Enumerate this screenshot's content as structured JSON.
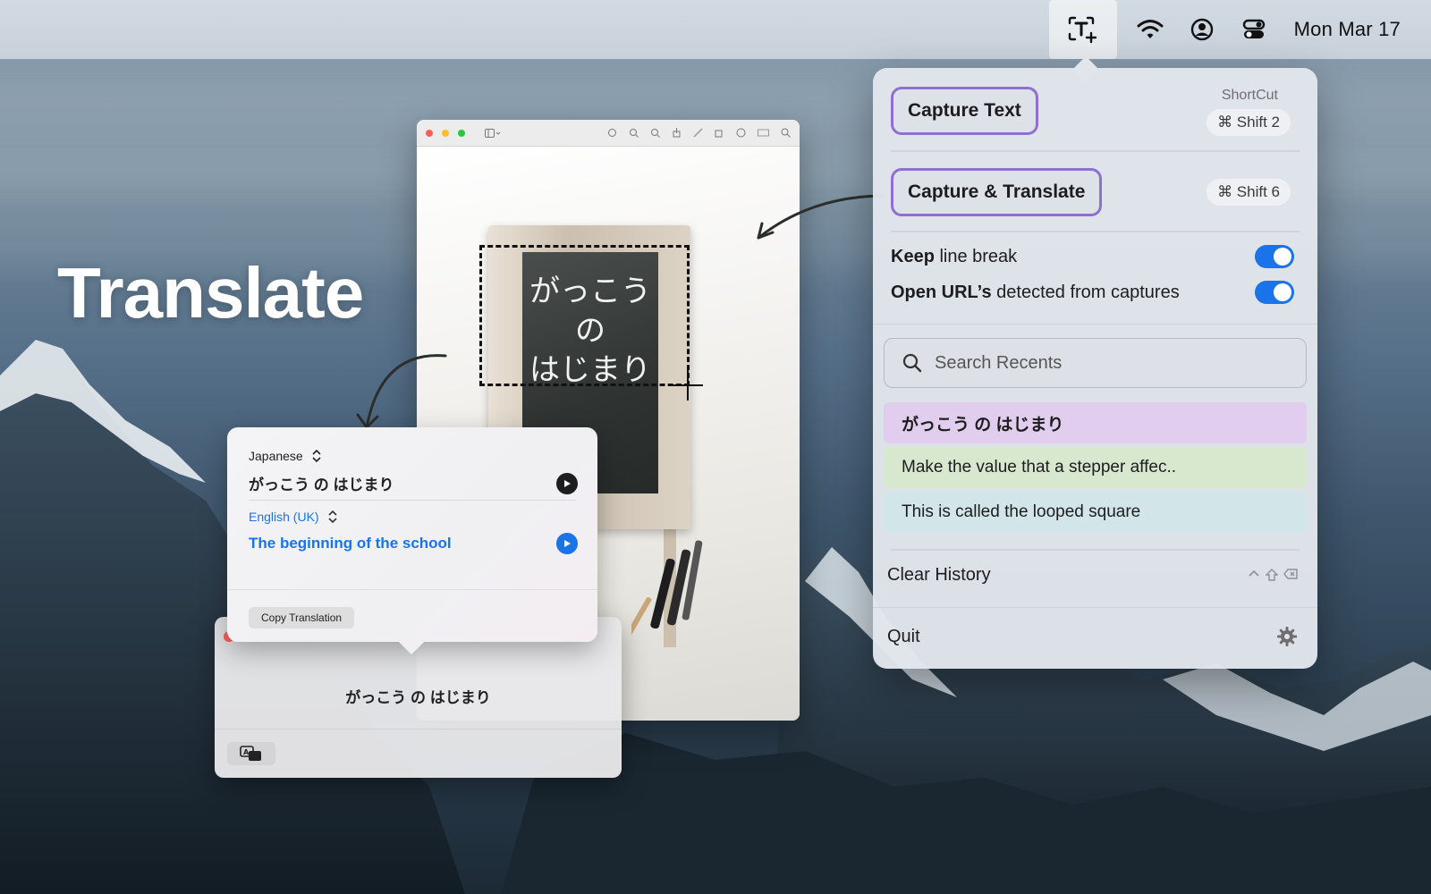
{
  "menubar": {
    "date": "Mon Mar 17",
    "icons": [
      "text-capture-icon",
      "wifi-icon",
      "user-icon",
      "control-center-icon"
    ]
  },
  "hero": {
    "title": "Translate"
  },
  "preview_window": {
    "board_text": [
      "がっこう",
      "の",
      "はじまり"
    ]
  },
  "translation_popover": {
    "source_language": "Japanese",
    "source_text": "がっこう の はじまり",
    "target_language": "English (UK)",
    "target_text": "The beginning of the school",
    "copy_button": "Copy Translation"
  },
  "result_window": {
    "text": "がっこう の はじまり"
  },
  "menu_panel": {
    "shortcut_label": "ShortCut",
    "capture_text": {
      "label": "Capture Text",
      "shortcut": "⌘ Shift 2"
    },
    "capture_translate": {
      "label": "Capture & Translate",
      "shortcut": "⌘ Shift 6"
    },
    "keep_line_break": {
      "bold": "Keep",
      "rest": " line break",
      "enabled": true
    },
    "open_urls": {
      "bold": "Open URL’s",
      "rest": " detected from captures",
      "enabled": true
    },
    "search_placeholder": "Search Recents",
    "recents": [
      {
        "text": "がっこう の はじまり",
        "color": "#e1cdee"
      },
      {
        "text": "Make the value that a stepper affec..",
        "color": "#d8e8cf"
      },
      {
        "text": "This is called the looped square",
        "color": "#d2e6ea"
      }
    ],
    "clear_history": "Clear History",
    "quit": "Quit"
  },
  "colors": {
    "accent_blue": "#1a73e8",
    "button_border_purple": "#8f6fcf"
  }
}
